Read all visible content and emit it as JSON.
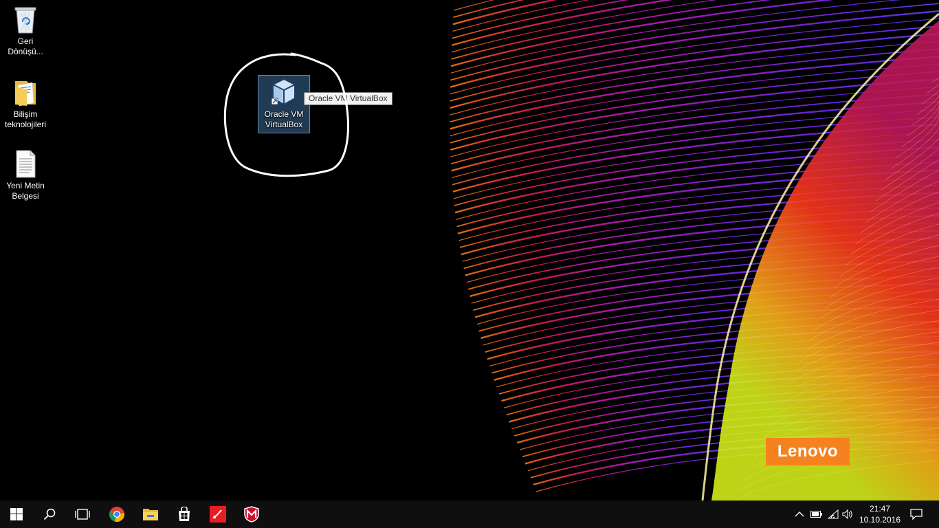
{
  "desktop": {
    "icons": [
      {
        "label": "Geri Dönüşü...",
        "icon": "recycle-bin-icon"
      },
      {
        "label": "Bilişim teknolojileri",
        "icon": "folder-icon"
      },
      {
        "label": "Yeni Metin Belgesi",
        "icon": "text-document-icon"
      },
      {
        "label": "Oracle VM VirtualBox",
        "icon": "virtualbox-icon",
        "selected": true
      }
    ],
    "tooltip": "Oracle VM VirtualBox",
    "brand_logo": "Lenovo"
  },
  "taskbar": {
    "pinned": [
      {
        "name": "start-button",
        "icon": "windows-logo-icon"
      },
      {
        "name": "search-button",
        "icon": "search-icon"
      },
      {
        "name": "task-view-button",
        "icon": "task-view-icon"
      },
      {
        "name": "chrome-button",
        "icon": "chrome-icon"
      },
      {
        "name": "file-explorer-button",
        "icon": "folder-icon"
      },
      {
        "name": "store-button",
        "icon": "store-icon"
      },
      {
        "name": "app-red-button",
        "icon": "red-app-icon"
      },
      {
        "name": "mcafee-button",
        "icon": "mcafee-icon"
      }
    ],
    "tray": {
      "time": "21:47",
      "date": "10.10.2016"
    }
  },
  "colors": {
    "taskbar": "#101010",
    "lenovo": "#f5821f",
    "selection": "#3b6e9b",
    "mcafee": "#c8102e"
  }
}
